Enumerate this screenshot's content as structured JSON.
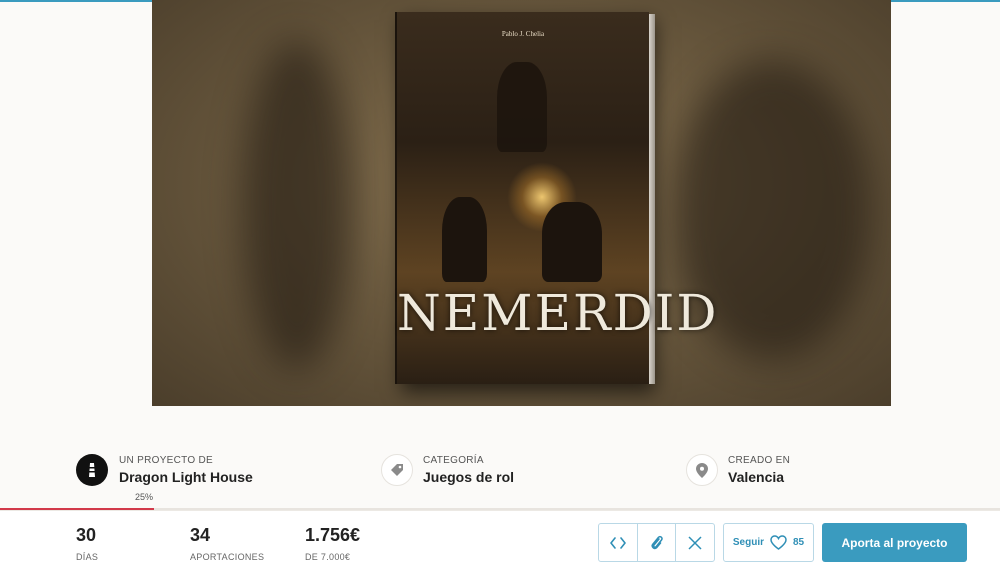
{
  "hero": {
    "book_author": "Pablo J. Chelia",
    "book_title": "NEMERDID"
  },
  "project": {
    "by_label": "UN PROYECTO DE",
    "creator": "Dragon Light House",
    "category_label": "CATEGORÍA",
    "category": "Juegos de rol",
    "created_label": "CREADO EN",
    "location": "Valencia"
  },
  "progress": {
    "percent_label": "25%",
    "fraction": 0.25
  },
  "stats": {
    "days": {
      "value": "30",
      "label": "DÍAS"
    },
    "contributions": {
      "value": "34",
      "label": "APORTACIONES"
    },
    "raised": {
      "value": "1.756€",
      "label": "DE 7.000€"
    }
  },
  "actions": {
    "follow_label": "Seguir",
    "follow_count": "85",
    "cta_label": "Aporta al proyecto"
  },
  "icons": {
    "embed": "code-icon",
    "link": "link-icon",
    "share": "x-twitter-icon",
    "favorite": "heart-icon",
    "category": "tag-icon",
    "location": "map-pin-icon"
  },
  "colors": {
    "accent": "#3a9bbf",
    "progress": "#d2394a"
  }
}
